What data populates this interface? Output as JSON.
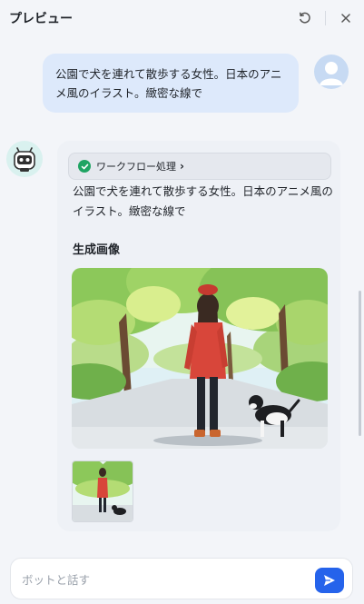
{
  "header": {
    "title": "プレビュー",
    "refresh_icon": "refresh-icon",
    "close_icon": "close-icon"
  },
  "messages": {
    "user": {
      "text": "公園で犬を連れて散歩する女性。日本のアニメ風のイラスト。緻密な線で",
      "avatar_icon": "user-avatar"
    },
    "bot": {
      "avatar_icon": "bot-avatar",
      "workflow_chip": {
        "label": "ワークフロー処理",
        "status": "success",
        "status_color": "#1fa463"
      },
      "text": "公園で犬を連れて散歩する女性。日本のアニメ風のイラスト。緻密な線で",
      "section_heading": "生成画像",
      "image_description": "anime-style woman in red coat walking a black and white dog on a park path",
      "thumbnail_count": 1
    }
  },
  "composer": {
    "placeholder": "ボットと話す",
    "value": "",
    "send_icon": "send-icon",
    "accent_color": "#2563eb"
  },
  "colors": {
    "background": "#f3f5f9",
    "user_bubble": "#dde9fb",
    "bot_card": "#eef1f6"
  }
}
